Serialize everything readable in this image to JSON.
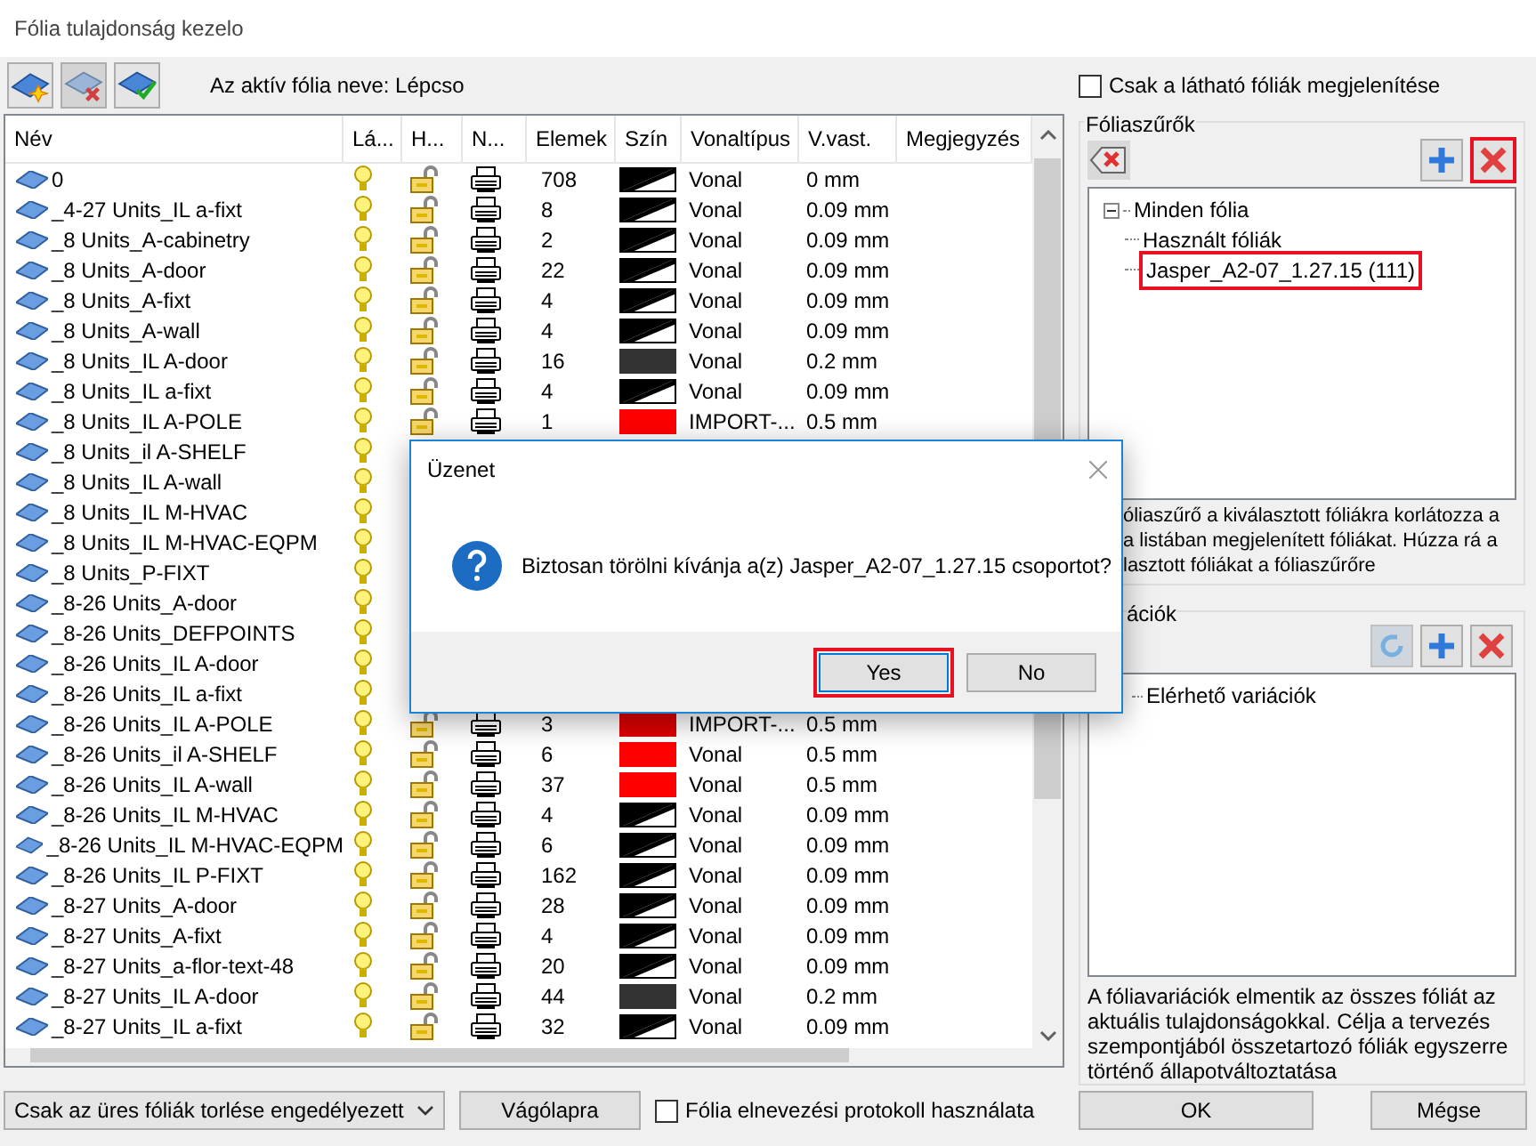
{
  "window": {
    "title": "Fólia tulajdonság kezelo"
  },
  "toolbar": {
    "active_layer_label": "Az aktív fólia neve: Lépcso"
  },
  "table": {
    "columns": [
      "Név",
      "Lá...",
      "H...",
      "N...",
      "Elemek",
      "Szín",
      "Vonaltípus",
      "V.vast.",
      "Megjegyzés"
    ],
    "rows": [
      {
        "name": "0",
        "elements": "708",
        "swatch": {
          "kind": "gradient"
        },
        "linetype": "Vonal",
        "weight": "0 mm"
      },
      {
        "name": "_4-27 Units_IL a-fixt",
        "elements": "8",
        "swatch": {
          "kind": "gradient"
        },
        "linetype": "Vonal",
        "weight": "0.09 mm"
      },
      {
        "name": "_8 Units_A-cabinetry",
        "elements": "2",
        "swatch": {
          "kind": "gradient"
        },
        "linetype": "Vonal",
        "weight": "0.09 mm"
      },
      {
        "name": "_8 Units_A-door",
        "elements": "22",
        "swatch": {
          "kind": "gradient"
        },
        "linetype": "Vonal",
        "weight": "0.09 mm"
      },
      {
        "name": "_8 Units_A-fixt",
        "elements": "4",
        "swatch": {
          "kind": "gradient"
        },
        "linetype": "Vonal",
        "weight": "0.09 mm"
      },
      {
        "name": "_8 Units_A-wall",
        "elements": "4",
        "swatch": {
          "kind": "gradient"
        },
        "linetype": "Vonal",
        "weight": "0.09 mm"
      },
      {
        "name": "_8 Units_IL A-door",
        "elements": "16",
        "swatch": {
          "kind": "solid",
          "color": "#333333"
        },
        "linetype": "Vonal",
        "weight": "0.2 mm"
      },
      {
        "name": "_8 Units_IL a-fixt",
        "elements": "4",
        "swatch": {
          "kind": "gradient"
        },
        "linetype": "Vonal",
        "weight": "0.09 mm"
      },
      {
        "name": "_8 Units_IL A-POLE",
        "elements": "1",
        "swatch": {
          "kind": "solid",
          "color": "#ff0000"
        },
        "linetype": "IMPORT-...",
        "weight": "0.5 mm"
      },
      {
        "name": "_8 Units_il A-SHELF"
      },
      {
        "name": "_8 Units_IL A-wall"
      },
      {
        "name": "_8 Units_IL M-HVAC"
      },
      {
        "name": "_8 Units_IL M-HVAC-EQPM"
      },
      {
        "name": "_8 Units_P-FIXT"
      },
      {
        "name": "_8-26 Units_A-door"
      },
      {
        "name": "_8-26 Units_DEFPOINTS"
      },
      {
        "name": "_8-26 Units_IL A-door"
      },
      {
        "name": "_8-26 Units_IL a-fixt"
      },
      {
        "name": "_8-26 Units_IL A-POLE",
        "elements": "3",
        "swatch": {
          "kind": "solid",
          "color": "#dd0000"
        },
        "linetype": "IMPORT-...",
        "weight": "0.5 mm"
      },
      {
        "name": "_8-26 Units_il A-SHELF",
        "elements": "6",
        "swatch": {
          "kind": "solid",
          "color": "#ff0000"
        },
        "linetype": "Vonal",
        "weight": "0.5 mm"
      },
      {
        "name": "_8-26 Units_IL A-wall",
        "elements": "37",
        "swatch": {
          "kind": "solid",
          "color": "#ff0000"
        },
        "linetype": "Vonal",
        "weight": "0.5 mm"
      },
      {
        "name": "_8-26 Units_IL M-HVAC",
        "elements": "4",
        "swatch": {
          "kind": "gradient"
        },
        "linetype": "Vonal",
        "weight": "0.09 mm"
      },
      {
        "name": "_8-26 Units_IL M-HVAC-EQPM",
        "elements": "6",
        "swatch": {
          "kind": "gradient"
        },
        "linetype": "Vonal",
        "weight": "0.09 mm"
      },
      {
        "name": "_8-26 Units_IL P-FIXT",
        "elements": "162",
        "swatch": {
          "kind": "gradient"
        },
        "linetype": "Vonal",
        "weight": "0.09 mm"
      },
      {
        "name": "_8-27 Units_A-door",
        "elements": "28",
        "swatch": {
          "kind": "gradient"
        },
        "linetype": "Vonal",
        "weight": "0.09 mm"
      },
      {
        "name": "_8-27 Units_A-fixt",
        "elements": "4",
        "swatch": {
          "kind": "gradient"
        },
        "linetype": "Vonal",
        "weight": "0.09 mm"
      },
      {
        "name": "_8-27 Units_a-flor-text-48",
        "elements": "20",
        "swatch": {
          "kind": "gradient"
        },
        "linetype": "Vonal",
        "weight": "0.09 mm"
      },
      {
        "name": "_8-27 Units_IL A-door",
        "elements": "44",
        "swatch": {
          "kind": "solid",
          "color": "#333333"
        },
        "linetype": "Vonal",
        "weight": "0.2 mm"
      },
      {
        "name": "_8-27 Units_IL a-fixt",
        "elements": "32",
        "swatch": {
          "kind": "gradient"
        },
        "linetype": "Vonal",
        "weight": "0.09 mm"
      }
    ]
  },
  "visible_only": {
    "label": "Csak a látható fóliák megjelenítése",
    "checked": false
  },
  "filters": {
    "title": "Fóliaszűrők",
    "delete_highlighted": true,
    "tree": [
      {
        "label": "Minden fólia",
        "expanded": true,
        "children": [
          {
            "label": "Használt fóliák",
            "highlighted": false
          },
          {
            "label": "Jasper_A2-07_1.27.15 (111)",
            "highlighted": true
          }
        ]
      }
    ],
    "help_lines": [
      "óliaszűrő a kiválasztott fóliákra korlátozza a",
      "a listában megjelenített fóliákat. Húzza rá a",
      "lasztott fóliákat a fóliaszűrőre"
    ]
  },
  "variations": {
    "title": "ációk",
    "tree": [
      {
        "label": "Elérhető variációk"
      }
    ],
    "help": "A fóliavariációk elmentik az összes fóliát az aktuális tulajdonságokkal. Célja a tervezés szempontjából összetartozó fóliák egyszerre történő állapotváltoztatása"
  },
  "bottom": {
    "dropdown": "Csak az üres fóliák torlése engedélyezett",
    "clipboard_button": "Vágólapra",
    "protocol": {
      "label": "Fólia elnevezési protokoll használata",
      "checked": false
    },
    "ok": "OK",
    "cancel": "Mégse"
  },
  "dialog": {
    "title": "Üzenet",
    "message": "Biztosan törölni kívánja a(z) Jasper_A2-07_1.27.15 csoportot?",
    "buttons": [
      {
        "label": "Yes",
        "highlighted": true
      },
      {
        "label": "No",
        "highlighted": false
      }
    ]
  }
}
